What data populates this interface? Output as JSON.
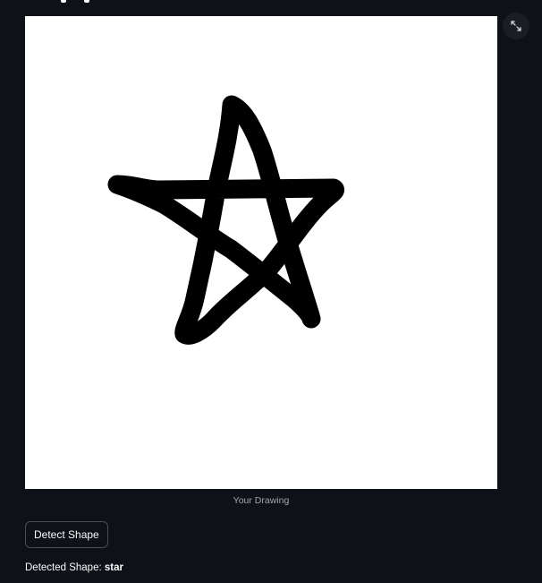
{
  "canvas": {
    "background_color": "#ffffff",
    "stroke_color": "#000000",
    "drawn_shape": "star"
  },
  "fullscreen": {
    "icon": "expand-icon"
  },
  "caption": "Your Drawing",
  "detect_button": {
    "label": "Detect Shape"
  },
  "result": {
    "label": "Detected Shape:",
    "value": "star"
  },
  "colors": {
    "background": "#0e1117",
    "text": "#fafafa",
    "caption_text": "#a2a6ad",
    "button_border": "#4a4d55"
  }
}
